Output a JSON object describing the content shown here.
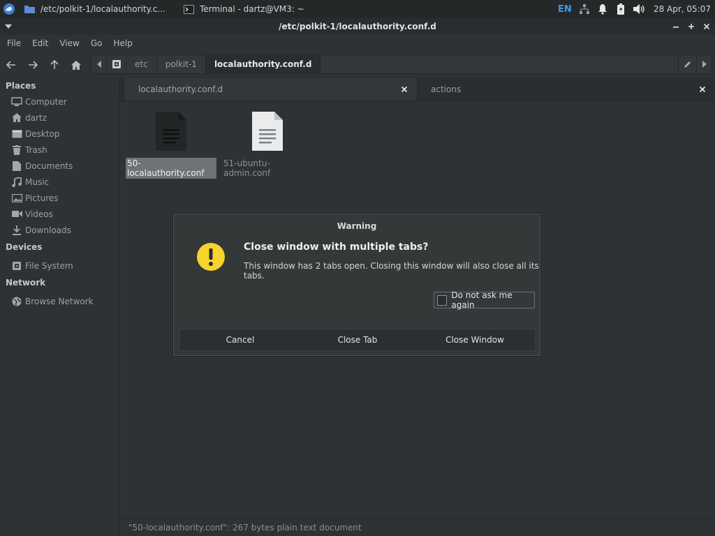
{
  "panel": {
    "tasks": [
      {
        "label": "/etc/polkit-1/localauthority.c...",
        "icon": "folder-icon"
      },
      {
        "label": "Terminal - dartz@VM3: ~",
        "icon": "terminal-icon"
      }
    ],
    "lang": "EN",
    "clock": "28 Apr, 05:07"
  },
  "window": {
    "title": "/etc/polkit-1/localauthority.conf.d"
  },
  "menubar": [
    "File",
    "Edit",
    "View",
    "Go",
    "Help"
  ],
  "pathbar": {
    "crumbs": [
      "etc",
      "polkit-1",
      "localauthority.conf.d"
    ]
  },
  "sidebar": {
    "places_header": "Places",
    "places": [
      {
        "label": "Computer",
        "icon": "computer-icon"
      },
      {
        "label": "dartz",
        "icon": "home-icon"
      },
      {
        "label": "Desktop",
        "icon": "desktop-icon"
      },
      {
        "label": "Trash",
        "icon": "trash-icon"
      },
      {
        "label": "Documents",
        "icon": "documents-icon"
      },
      {
        "label": "Music",
        "icon": "music-icon"
      },
      {
        "label": "Pictures",
        "icon": "pictures-icon"
      },
      {
        "label": "Videos",
        "icon": "videos-icon"
      },
      {
        "label": "Downloads",
        "icon": "downloads-icon"
      }
    ],
    "devices_header": "Devices",
    "devices": [
      {
        "label": "File System",
        "icon": "drive-icon"
      }
    ],
    "network_header": "Network",
    "network": [
      {
        "label": "Browse Network",
        "icon": "network-globe-icon"
      }
    ]
  },
  "tabs": [
    {
      "label": "localauthority.conf.d"
    },
    {
      "label": "actions"
    }
  ],
  "files": [
    {
      "name": "50-localauthority.conf",
      "selected": true
    },
    {
      "name": "51-ubuntu-admin.conf",
      "selected": false
    }
  ],
  "statusbar": "\"50-localauthority.conf\": 267 bytes plain text document",
  "dialog": {
    "title": "Warning",
    "heading": "Close window with multiple tabs?",
    "message": "This window has 2 tabs open. Closing this window will also close all its tabs.",
    "checkbox_label": "Do not ask me again",
    "checkbox_checked": false,
    "buttons": [
      "Cancel",
      "Close Tab",
      "Close Window"
    ]
  },
  "colors": {
    "accent": "#3d9be9",
    "warning": "#f6d32d"
  }
}
